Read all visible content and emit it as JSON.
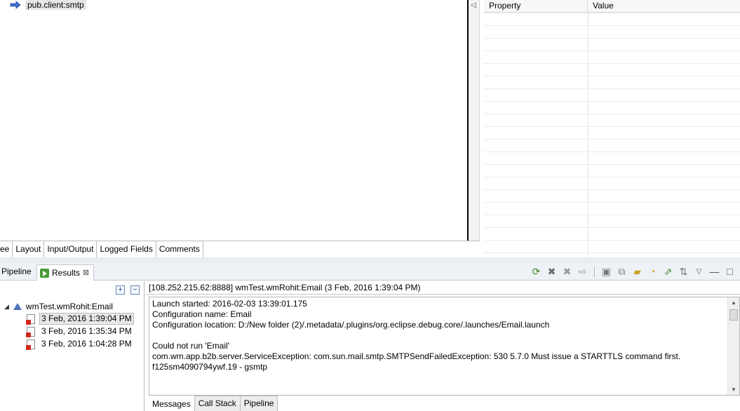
{
  "editor": {
    "node_label": "pub.client:smtp",
    "tabs": [
      "ee",
      "Layout",
      "Input/Output",
      "Logged Fields",
      "Comments"
    ]
  },
  "properties": {
    "columns": [
      "Property",
      "Value"
    ]
  },
  "views": {
    "pipeline_tab": "Pipeline",
    "results_tab": "Results",
    "toolbar_icons": [
      "rerun-icon",
      "remove-icon",
      "remove-all-icon",
      "forward-icon",
      "save-icon",
      "save-all-icon",
      "open-folder-icon",
      "load-icon",
      "export-icon",
      "sort-icon",
      "view-menu-icon",
      "minimize-icon",
      "maximize-icon"
    ]
  },
  "tree": {
    "root": "wmTest.wmRohit:Email",
    "items": [
      "3 Feb, 2016 1:39:04 PM",
      "3 Feb, 2016 1:35:34 PM",
      "3 Feb, 2016 1:04:28 PM"
    ]
  },
  "result": {
    "header": "[108.252.215.62:8888] wmTest.wmRohit:Email (3 Feb, 2016 1:39:04 PM)",
    "lines": [
      "Launch started: 2016-02-03 13:39:01.175",
      "Configuration name: Email",
      "Configuration location: D:/New folder (2)/.metadata/.plugins/org.eclipse.debug.core/.launches/Email.launch",
      "",
      "Could not run 'Email'",
      "com.wm.app.b2b.server.ServiceException: com.sun.mail.smtp.SMTPSendFailedException: 530 5.7.0 Must issue a STARTTLS command first.",
      "f125sm4090794ywf.19 - gsmtp"
    ],
    "tabs": [
      "Messages",
      "Call Stack",
      "Pipeline"
    ]
  },
  "colors": {
    "accent_blue": "#4f6fb7",
    "error_red": "#d0271d",
    "run_green": "#4a9a3a"
  }
}
